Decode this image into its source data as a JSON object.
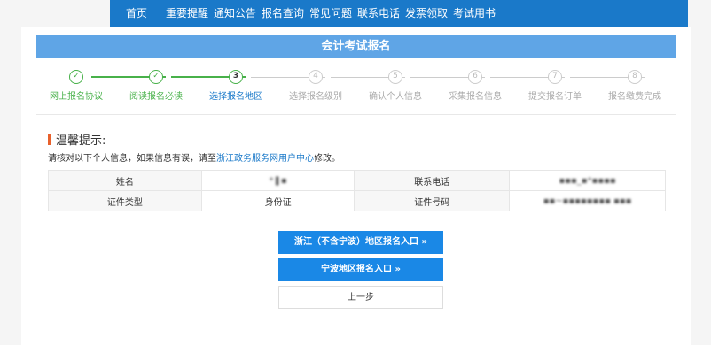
{
  "nav": {
    "items": [
      "首页",
      "重要提醒",
      "通知公告",
      "报名查询",
      "常见问题",
      "联系电话",
      "发票领取",
      "考试用书"
    ]
  },
  "page": {
    "title": "会计考试报名"
  },
  "steps": [
    {
      "num": "✓",
      "label": "网上报名协议",
      "state": "done"
    },
    {
      "num": "✓",
      "label": "阅读报名必读",
      "state": "done"
    },
    {
      "num": "3",
      "label": "选择报名地区",
      "state": "active"
    },
    {
      "num": "4",
      "label": "选择报名级别",
      "state": "pending"
    },
    {
      "num": "5",
      "label": "确认个人信息",
      "state": "pending"
    },
    {
      "num": "6",
      "label": "采集报名信息",
      "state": "pending"
    },
    {
      "num": "7",
      "label": "提交报名订单",
      "state": "pending"
    },
    {
      "num": "8",
      "label": "报名缴费完成",
      "state": "pending"
    }
  ],
  "tip": {
    "heading": "温馨提示:",
    "text_before": "请核对以下个人信息，如果信息有误，请至",
    "link": "浙江政务服务网用户中心",
    "text_after": "修改。"
  },
  "info": {
    "name_label": "姓名",
    "name_value": "*❚▪",
    "phone_label": "联系电话",
    "phone_value": "▪▪▪_▪*▪▪▪▪",
    "id_type_label": "证件类型",
    "id_type_value": "身份证",
    "id_no_label": "证件号码",
    "id_no_value": "▪▪~▪▪▪▪▪▪▪▪ ▪▪▪"
  },
  "buttons": {
    "zhejiang": "浙江（不含宁波）地区报名入口 »",
    "ningbo": "宁波地区报名入口 »",
    "back": "上一步"
  },
  "colors": {
    "brand": "#1a79c9",
    "done": "#48b14a",
    "accent": "#e8612c"
  }
}
